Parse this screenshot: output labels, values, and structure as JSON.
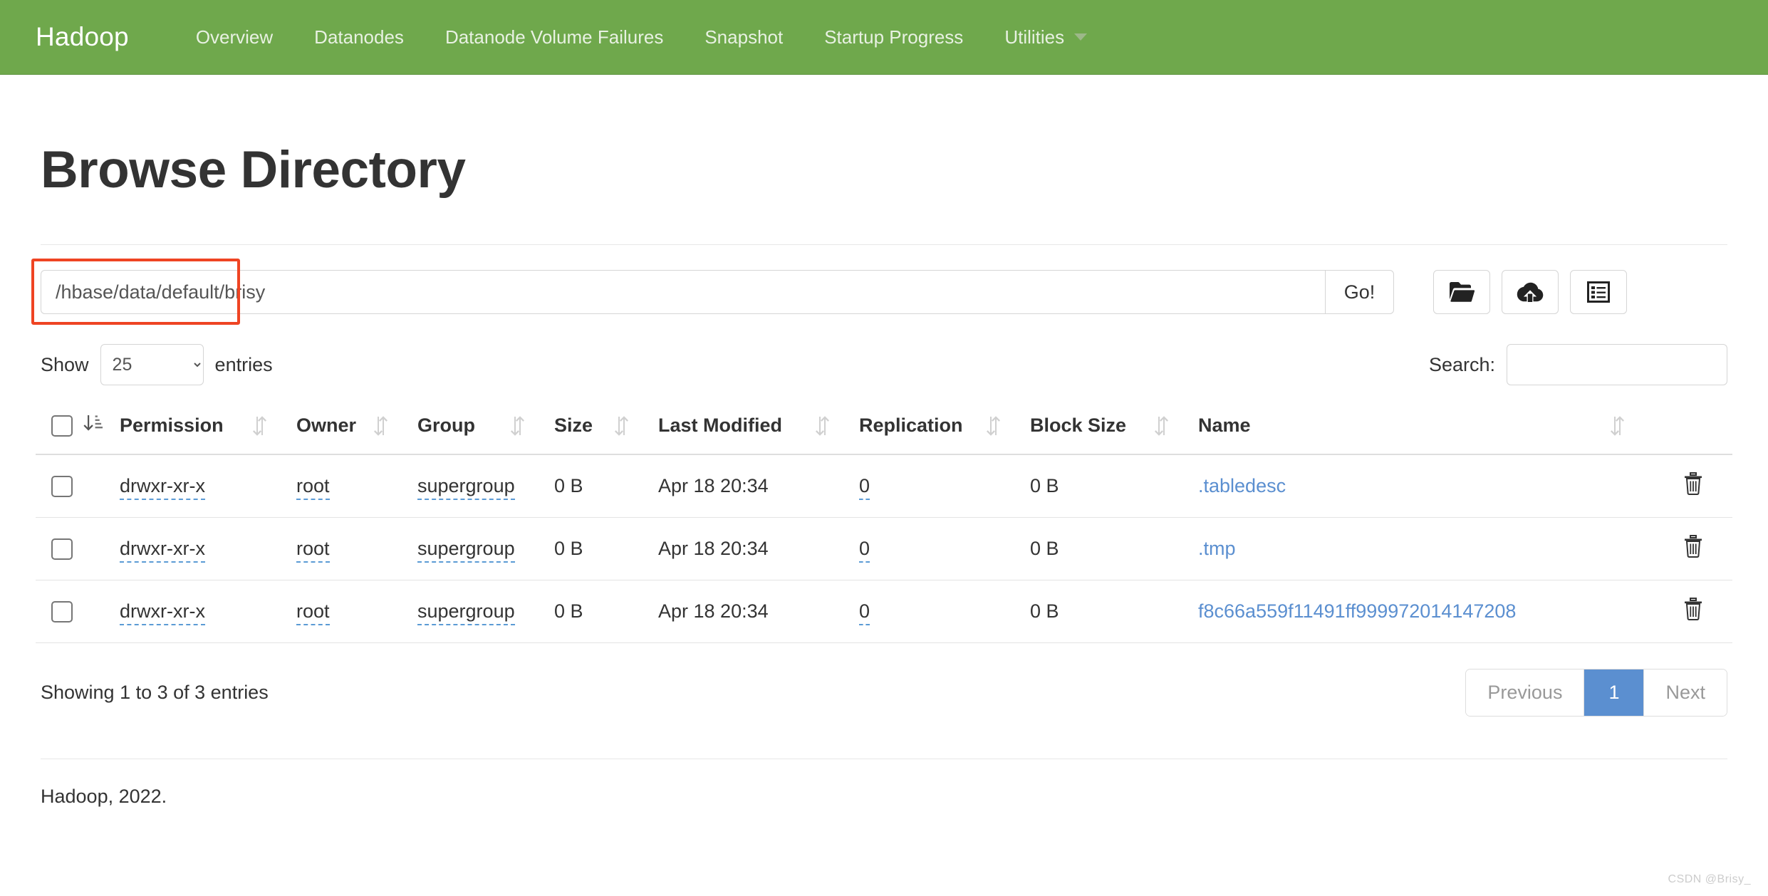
{
  "navbar": {
    "brand": "Hadoop",
    "links": [
      {
        "label": "Overview"
      },
      {
        "label": "Datanodes"
      },
      {
        "label": "Datanode Volume Failures"
      },
      {
        "label": "Snapshot"
      },
      {
        "label": "Startup Progress"
      },
      {
        "label": "Utilities",
        "dropdown": true
      }
    ],
    "background_color": "#6fa84c"
  },
  "page": {
    "title": "Browse Directory"
  },
  "path_bar": {
    "value": "/hbase/data/default/brisy",
    "placeholder": "",
    "go_label": "Go!",
    "tools": [
      {
        "icon": "folder-open-icon",
        "name": "create-directory-button"
      },
      {
        "icon": "cloud-upload-icon",
        "name": "upload-files-button"
      },
      {
        "icon": "list-alt-icon",
        "name": "cut-paste-button"
      }
    ],
    "highlight_color": "#ef4423"
  },
  "controls": {
    "show_label": "Show",
    "entries_label": "entries",
    "page_length": "25",
    "page_length_options": [
      "25"
    ],
    "search_label": "Search:",
    "search_value": "",
    "search_placeholder": ""
  },
  "table": {
    "columns": [
      {
        "label": "Permission"
      },
      {
        "label": "Owner"
      },
      {
        "label": "Group"
      },
      {
        "label": "Size"
      },
      {
        "label": "Last Modified"
      },
      {
        "label": "Replication"
      },
      {
        "label": "Block Size"
      },
      {
        "label": "Name"
      }
    ],
    "rows": [
      {
        "permission": "drwxr-xr-x",
        "owner": "root",
        "group": "supergroup",
        "size": "0 B",
        "last_modified": "Apr 18 20:34",
        "replication": "0",
        "block_size": "0 B",
        "name": ".tabledesc"
      },
      {
        "permission": "drwxr-xr-x",
        "owner": "root",
        "group": "supergroup",
        "size": "0 B",
        "last_modified": "Apr 18 20:34",
        "replication": "0",
        "block_size": "0 B",
        "name": ".tmp"
      },
      {
        "permission": "drwxr-xr-x",
        "owner": "root",
        "group": "supergroup",
        "size": "0 B",
        "last_modified": "Apr 18 20:34",
        "replication": "0",
        "block_size": "0 B",
        "name": "f8c66a559f11491ff999972014147208"
      }
    ]
  },
  "table_footer": {
    "info": "Showing 1 to 3 of 3 entries",
    "previous_label": "Previous",
    "page_1_label": "1",
    "next_label": "Next",
    "active_page_color": "#5b8fd0"
  },
  "footer": {
    "text": "Hadoop, 2022."
  },
  "watermark": {
    "text": "CSDN @Brisy_"
  }
}
